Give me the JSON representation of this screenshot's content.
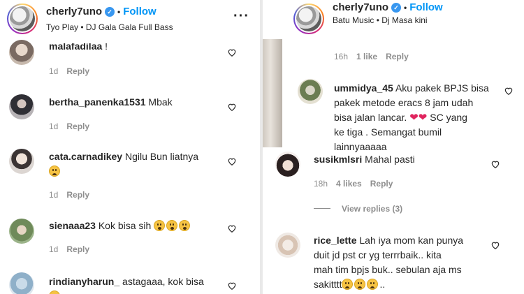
{
  "left": {
    "header": {
      "username": "cherly7uno",
      "follow": "Follow",
      "subtitle": "Tyo Play • DJ Gala Gala Full Bass",
      "separator": "•"
    },
    "comments": [
      {
        "user": "malafadilaa",
        "text": "!",
        "time": "1d",
        "reply": "Reply"
      },
      {
        "user": "bertha_panenka1531",
        "text": "Mbak",
        "time": "1d",
        "reply": "Reply"
      },
      {
        "user": "cata.carnadikey",
        "text": "Ngilu Bun liatnya",
        "time": "1d",
        "reply": "Reply"
      },
      {
        "user": "sienaaa23",
        "text": "Kok bisa sih",
        "time": "1d",
        "reply": "Reply"
      },
      {
        "user": "rindianyharun_",
        "text": "astagaaa, kok bisa"
      }
    ]
  },
  "right": {
    "header": {
      "username": "cherly7uno",
      "follow": "Follow",
      "subtitle": "Batu Music • Dj Masa kini",
      "separator": "•"
    },
    "prev_meta": {
      "time": "16h",
      "likes": "1 like",
      "reply": "Reply"
    },
    "comments": [
      {
        "user": "ummidya_45",
        "text_1": "Aku pakek BPJS bisa",
        "text_2": "pakek metode eracs 8 jam udah",
        "text_3": "bisa jalan lancar.",
        "text_3b": "SC yang",
        "text_4": "ke tiga . Semangat bumil",
        "text_5": "lainnyaaaaa"
      },
      {
        "user": "susikmlsri",
        "text": "Mahal pasti",
        "time": "18h",
        "likes": "4 likes",
        "reply": "Reply",
        "view_replies": "View replies (3)"
      },
      {
        "user": "rice_lette",
        "text_1": "Lah iya mom kan punya",
        "text_2": "duit jd pst cr yg terrrbaik.. kita",
        "text_3": "mah tim bpjs buk.. sebulan aja ms",
        "text_4": "sakitttt",
        "text_4b": ".."
      }
    ]
  },
  "icons": {
    "more": "more-horizontal-icon",
    "heart": "heart-outline-icon",
    "verified": "verified-badge-icon"
  },
  "colors": {
    "follow": "#0095f6",
    "meta": "#8e8e8e",
    "verified": "#3897f0"
  }
}
